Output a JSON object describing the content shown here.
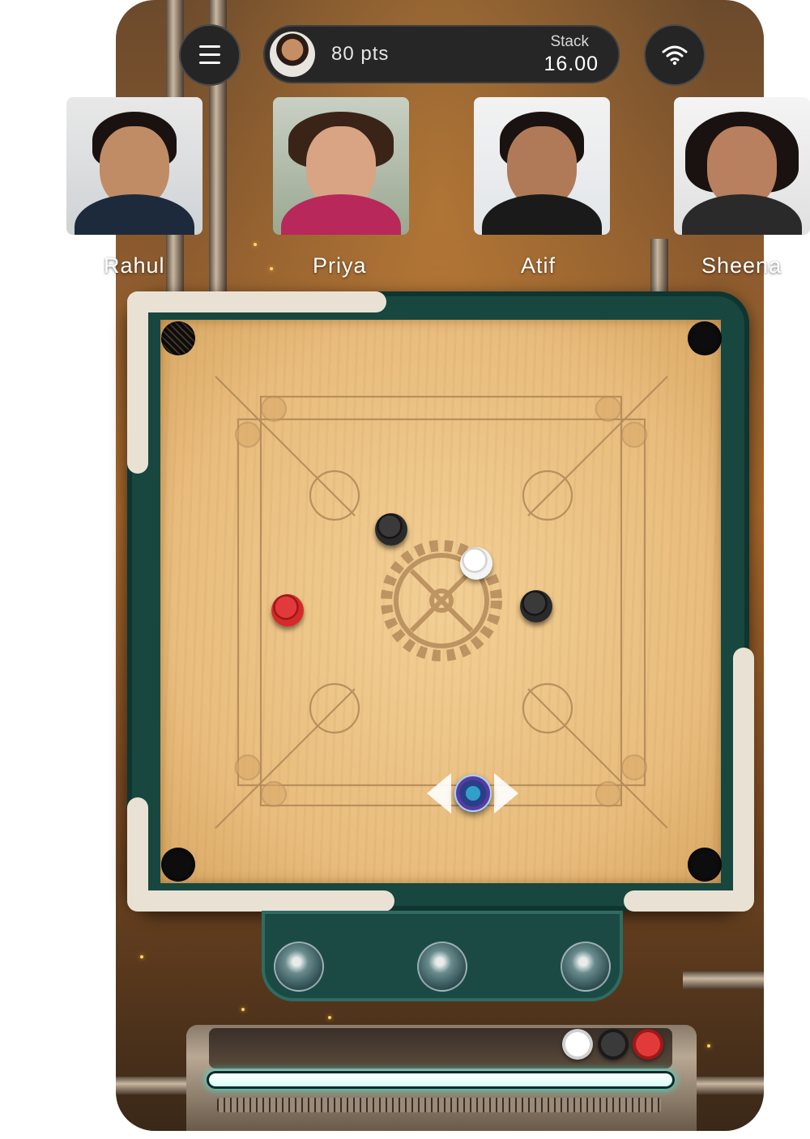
{
  "header": {
    "menu_icon": "hamburger-icon",
    "score": {
      "points_label": "80 pts",
      "stack_label": "Stack",
      "stack_value": "16.00"
    },
    "wifi_icon": "wifi-icon"
  },
  "players": [
    {
      "name": "Rahul"
    },
    {
      "name": "Priya"
    },
    {
      "name": "Atif"
    },
    {
      "name": "Sheena"
    }
  ],
  "board": {
    "coins": [
      {
        "color": "black"
      },
      {
        "color": "white"
      },
      {
        "color": "black"
      },
      {
        "color": "red"
      }
    ],
    "striker": "striker-icon",
    "colors": {
      "frame": "#17473f",
      "wood": "#e8bc7c",
      "rail": "#e9e2d4"
    }
  },
  "footer": {
    "power_fraction": 1.0,
    "coin_legend": [
      "white",
      "black",
      "red"
    ]
  }
}
